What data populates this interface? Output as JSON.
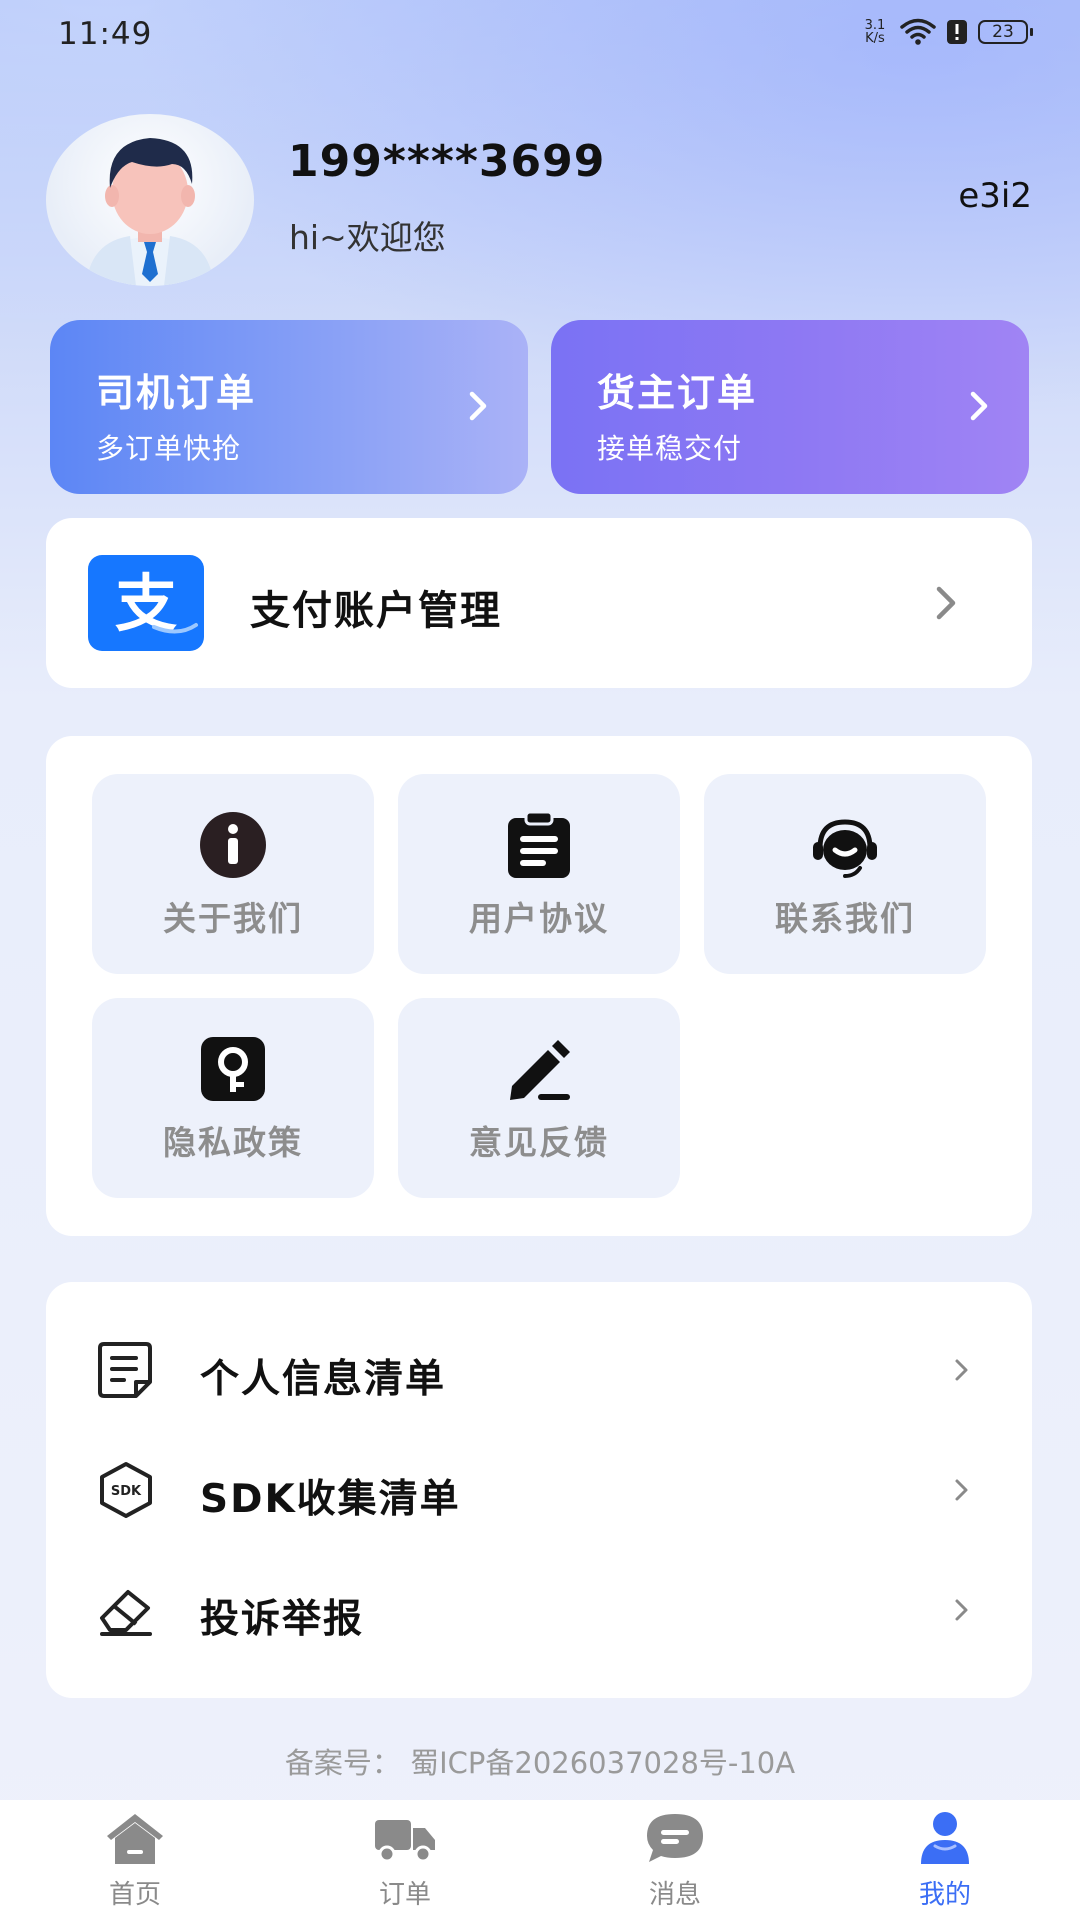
{
  "status_bar": {
    "time": "11:49",
    "net_speed_value": "3.1",
    "net_speed_unit": "K/s",
    "battery": "23"
  },
  "profile": {
    "phone": "199****3699",
    "welcome": "hi~欢迎您",
    "code": "e3i2"
  },
  "orders": {
    "driver": {
      "title": "司机订单",
      "subtitle": "多订单快抢"
    },
    "shipper": {
      "title": "货主订单",
      "subtitle": "接单稳交付"
    }
  },
  "payment": {
    "label": "支付账户管理",
    "logo_char": "支"
  },
  "grid": [
    {
      "label": "关于我们",
      "icon": "info-icon"
    },
    {
      "label": "用户协议",
      "icon": "clipboard-icon"
    },
    {
      "label": "联系我们",
      "icon": "headset-icon"
    },
    {
      "label": "隐私政策",
      "icon": "key-lock-icon"
    },
    {
      "label": "意见反馈",
      "icon": "pen-icon"
    }
  ],
  "list": [
    {
      "label": "个人信息清单",
      "icon": "document-icon"
    },
    {
      "label": "SDK收集清单",
      "icon": "sdk-icon"
    },
    {
      "label": "投诉举报",
      "icon": "eraser-icon"
    }
  ],
  "filing": "备案号：   蜀ICP备2026037028号-10A",
  "nav": [
    {
      "label": "首页",
      "icon": "home-icon"
    },
    {
      "label": "订单",
      "icon": "truck-icon"
    },
    {
      "label": "消息",
      "icon": "message-icon"
    },
    {
      "label": "我的",
      "icon": "user-icon"
    }
  ],
  "colors": {
    "accent": "#3b6ef5",
    "driver_card": "#6f93f5",
    "shipper_card": "#8676f4",
    "alipay_blue": "#1677ff",
    "tile_bg": "#edf1fb"
  }
}
